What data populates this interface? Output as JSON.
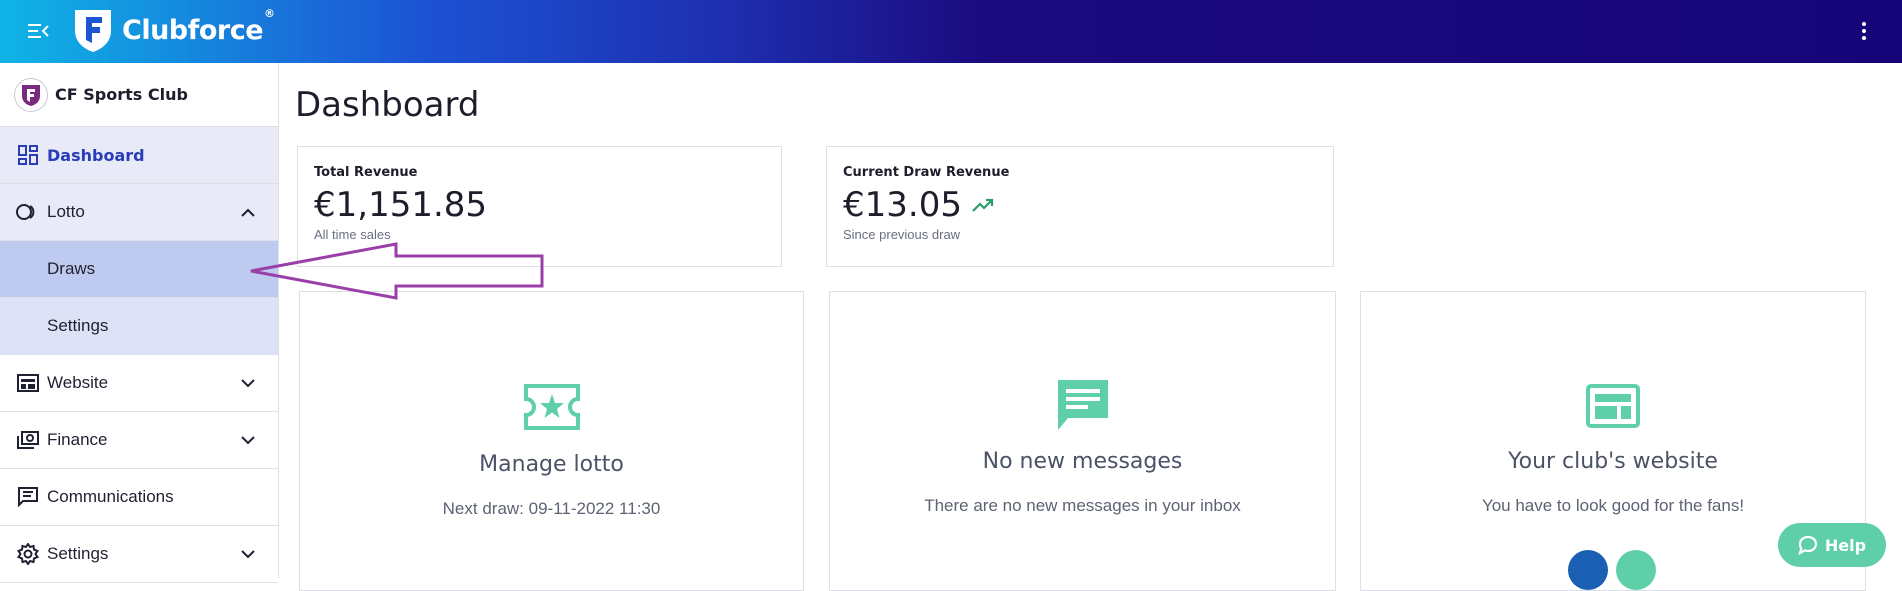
{
  "header": {
    "brand": "Clubforce",
    "brand_mark": "®",
    "colors": {
      "gradient_start": "#0fb4e6",
      "gradient_end": "#160579"
    }
  },
  "sidebar": {
    "club_name": "CF Sports Club",
    "items": [
      {
        "label": "Dashboard",
        "icon": "dashboard-icon",
        "state": "active"
      },
      {
        "label": "Lotto",
        "icon": "lotto-icon",
        "state": "expanded"
      },
      {
        "label": "Draws",
        "sub": true,
        "state": "selected"
      },
      {
        "label": "Settings",
        "sub": true
      },
      {
        "label": "Website",
        "icon": "website-icon",
        "state": "collapsed"
      },
      {
        "label": "Finance",
        "icon": "finance-icon",
        "state": "collapsed"
      },
      {
        "label": "Communications",
        "icon": "communications-icon"
      },
      {
        "label": "Settings",
        "icon": "gear-icon",
        "state": "collapsed"
      }
    ]
  },
  "main": {
    "title": "Dashboard",
    "stats": [
      {
        "label": "Total Revenue",
        "value": "€1,151.85",
        "sub": "All time sales"
      },
      {
        "label": "Current Draw Revenue",
        "value": "€13.05",
        "sub": "Since previous draw",
        "trend": "trending-up-icon"
      }
    ],
    "features": [
      {
        "title": "Manage lotto",
        "text": "Next draw: 09-11-2022 11:30",
        "icon": "ticket-star-icon"
      },
      {
        "title": "No new messages",
        "text": "There are no new messages in your inbox",
        "icon": "message-icon"
      },
      {
        "title": "Your club's website",
        "text": "You have to look good for the fans!",
        "icon": "website-layout-icon"
      }
    ],
    "accent_color": "#5ecfa8"
  },
  "help": {
    "label": "Help"
  }
}
